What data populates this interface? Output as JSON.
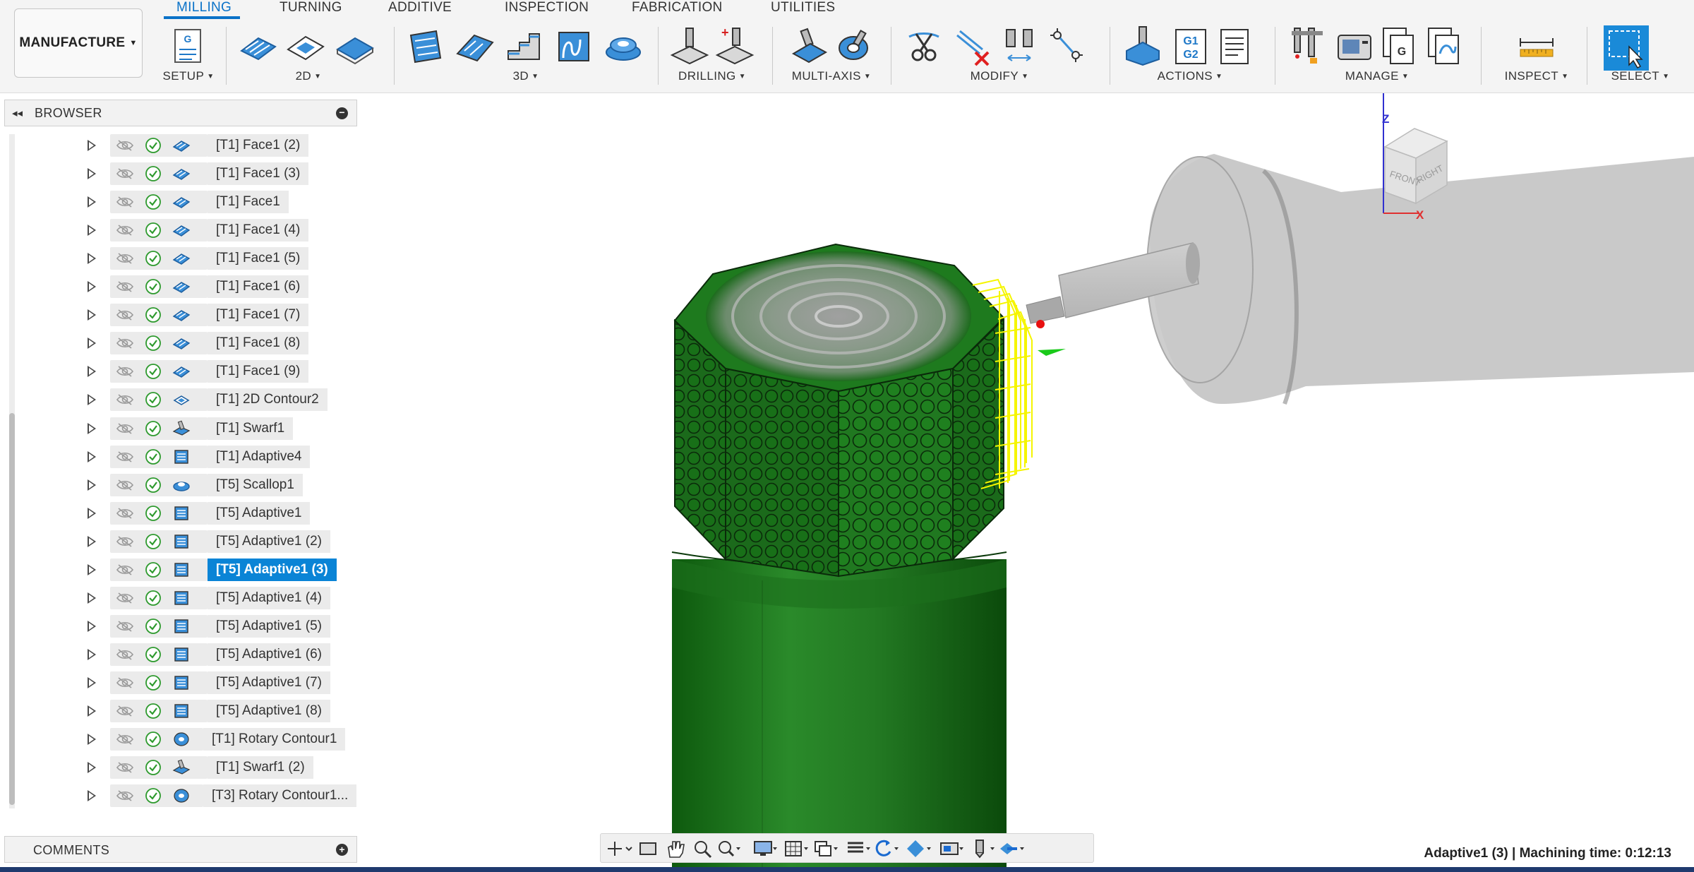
{
  "workspace": {
    "label": "MANUFACTURE"
  },
  "tabs": [
    {
      "label": "MILLING",
      "active": true
    },
    {
      "label": "TURNING"
    },
    {
      "label": "ADDITIVE"
    },
    {
      "label": "INSPECTION"
    },
    {
      "label": "FABRICATION"
    },
    {
      "label": "UTILITIES"
    }
  ],
  "groups": {
    "setup": "SETUP",
    "two_d": "2D",
    "three_d": "3D",
    "drilling": "DRILLING",
    "multi_axis": "MULTI-AXIS",
    "modify": "MODIFY",
    "actions": "ACTIONS",
    "manage": "MANAGE",
    "inspect": "INSPECT",
    "select": "SELECT"
  },
  "icon_text": {
    "setup_g": "G",
    "g1g2_top": "G1",
    "g1g2_bottom": "G2",
    "manage_g": "G"
  },
  "browser": {
    "title": "BROWSER",
    "items": [
      {
        "label": "[T1] Face1 (2)",
        "icon": "face-icon"
      },
      {
        "label": "[T1] Face1 (3)",
        "icon": "face-icon"
      },
      {
        "label": "[T1] Face1",
        "icon": "face-icon"
      },
      {
        "label": "[T1] Face1 (4)",
        "icon": "face-icon"
      },
      {
        "label": "[T1] Face1 (5)",
        "icon": "face-icon"
      },
      {
        "label": "[T1] Face1 (6)",
        "icon": "face-icon"
      },
      {
        "label": "[T1] Face1 (7)",
        "icon": "face-icon"
      },
      {
        "label": "[T1] Face1 (8)",
        "icon": "face-icon"
      },
      {
        "label": "[T1] Face1 (9)",
        "icon": "face-icon"
      },
      {
        "label": "[T1] 2D Contour2",
        "icon": "contour-2d-icon"
      },
      {
        "label": "[T1] Swarf1",
        "icon": "swarf-icon"
      },
      {
        "label": "[T1] Adaptive4",
        "icon": "adaptive-icon"
      },
      {
        "label": "[T5] Scallop1",
        "icon": "scallop-icon"
      },
      {
        "label": "[T5] Adaptive1",
        "icon": "adaptive-icon"
      },
      {
        "label": "[T5] Adaptive1 (2)",
        "icon": "adaptive-icon"
      },
      {
        "label": "[T5] Adaptive1 (3)",
        "icon": "adaptive-icon",
        "selected": true
      },
      {
        "label": "[T5] Adaptive1 (4)",
        "icon": "adaptive-icon"
      },
      {
        "label": "[T5] Adaptive1 (5)",
        "icon": "adaptive-icon"
      },
      {
        "label": "[T5] Adaptive1 (6)",
        "icon": "adaptive-icon"
      },
      {
        "label": "[T5] Adaptive1 (7)",
        "icon": "adaptive-icon"
      },
      {
        "label": "[T5] Adaptive1 (8)",
        "icon": "adaptive-icon"
      },
      {
        "label": "[T1] Rotary Contour1",
        "icon": "rotary-contour-icon"
      },
      {
        "label": "[T1] Swarf1 (2)",
        "icon": "swarf-icon"
      },
      {
        "label": "[T3] Rotary Contour1...",
        "icon": "rotary-contour-icon"
      }
    ]
  },
  "comments": {
    "title": "COMMENTS"
  },
  "viewcube": {
    "top_axis": "Z",
    "right_axis": "X",
    "front": "FRONT",
    "right": "RIGHT"
  },
  "status": {
    "text": "Adaptive1 (3) | Machining time: 0:12:13"
  },
  "colors": {
    "accent": "#0a84d6",
    "part_green": "#1f7a1f",
    "toolpath_yellow": "#f5f500",
    "check_green": "#2e9a2e"
  }
}
